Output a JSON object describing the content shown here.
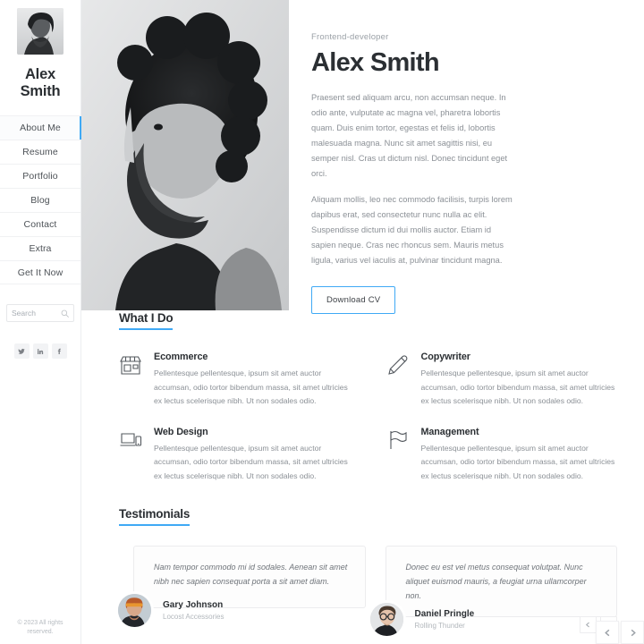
{
  "sidebar": {
    "avatar_alt": "alex-smith-avatar",
    "brand_name": "Alex Smith",
    "nav_items": [
      {
        "label": "About Me",
        "active": true
      },
      {
        "label": "Resume",
        "active": false
      },
      {
        "label": "Portfolio",
        "active": false
      },
      {
        "label": "Blog",
        "active": false
      },
      {
        "label": "Contact",
        "active": false
      },
      {
        "label": "Extra",
        "active": false
      },
      {
        "label": "Get It Now",
        "active": false
      }
    ],
    "search": {
      "placeholder": "Search",
      "value": "",
      "icon": "search-icon"
    },
    "socials": [
      {
        "name": "twitter-icon",
        "label": "Twitter"
      },
      {
        "name": "linkedin-icon",
        "label": "LinkedIn"
      },
      {
        "name": "facebook-icon",
        "label": "Facebook"
      }
    ],
    "copyright": "© 2023 All rights reserved."
  },
  "hero": {
    "photo_alt": "portrait-photo-bearded-man",
    "role": "Frontend-developer",
    "name": "Alex Smith",
    "paragraph1": "Praesent sed aliquam arcu, non accumsan neque. In odio ante, vulputate ac magna vel, pharetra lobortis quam. Duis enim tortor, egestas et felis id, lobortis malesuada magna. Nunc sit amet sagittis nisi, eu semper nisl. Cras ut dictum nisl. Donec tincidunt eget orci.",
    "paragraph2": "Aliquam mollis, leo nec commodo facilisis, turpis lorem dapibus erat, sed consectetur nunc nulla ac elit. Suspendisse dictum id dui mollis auctor. Etiam id sapien neque. Cras nec rhoncus sem. Mauris metus ligula, varius vel iaculis at, pulvinar tincidunt magna.",
    "cta_label": "Download CV"
  },
  "what_i_do": {
    "title": "What I Do",
    "services": [
      {
        "icon": "storefront-icon",
        "title": "Ecommerce",
        "desc": "Pellentesque pellentesque, ipsum sit amet auctor accumsan, odio tortor bibendum massa, sit amet ultricies ex lectus scelerisque nibh. Ut non sodales odio."
      },
      {
        "icon": "pencil-icon",
        "title": "Copywriter",
        "desc": "Pellentesque pellentesque, ipsum sit amet auctor accumsan, odio tortor bibendum massa, sit amet ultricies ex lectus scelerisque nibh. Ut non sodales odio."
      },
      {
        "icon": "laptop-mobile-icon",
        "title": "Web Design",
        "desc": "Pellentesque pellentesque, ipsum sit amet auctor accumsan, odio tortor bibendum massa, sit amet ultricies ex lectus scelerisque nibh. Ut non sodales odio."
      },
      {
        "icon": "flag-icon",
        "title": "Management",
        "desc": "Pellentesque pellentesque, ipsum sit amet auctor accumsan, odio tortor bibendum massa, sit amet ultricies ex lectus scelerisque nibh. Ut non sodales odio."
      }
    ]
  },
  "testimonials": {
    "title": "Testimonials",
    "items": [
      {
        "quote": "Nam tempor commodo mi id sodales. Aenean sit amet nibh nec sapien consequat porta a sit amet diam.",
        "name": "Gary Johnson",
        "role": "Locost Accessories",
        "avatar_alt": "gary-johnson-avatar"
      },
      {
        "quote": "Donec eu est vel metus consequat volutpat. Nunc aliquet euismod mauris, a feugiat urna ullamcorper non.",
        "name": "Daniel Pringle",
        "role": "Rolling Thunder",
        "avatar_alt": "daniel-pringle-avatar"
      }
    ],
    "nav": {
      "prev": "chevron-left-icon",
      "next": "chevron-right-icon"
    }
  },
  "float_nav": {
    "prev": "chevron-left-icon",
    "next": "chevron-right-icon"
  },
  "colors": {
    "accent": "#3fa9f5",
    "text_dark": "#2b2f33",
    "text_muted": "#8b9096",
    "border": "#eceef0",
    "bg": "#ffffff"
  }
}
